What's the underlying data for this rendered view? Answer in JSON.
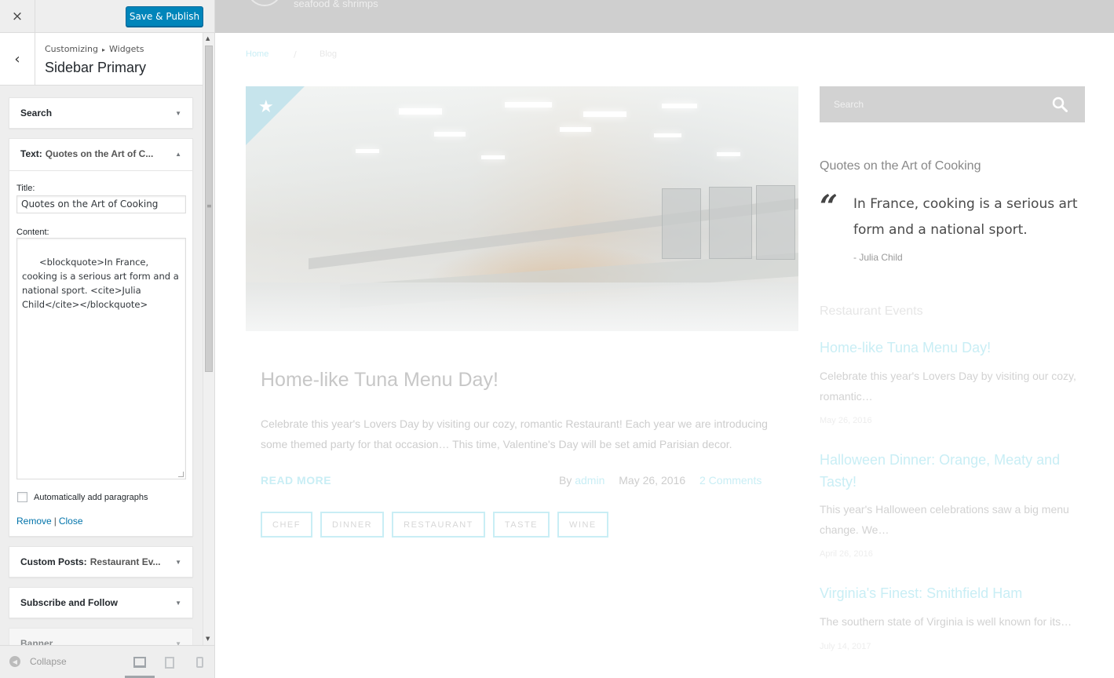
{
  "customizer": {
    "close_icon": "×",
    "publish_label": "Save & Publish",
    "back_icon": "‹",
    "breadcrumb": {
      "root": "Customizing",
      "separator": "▸",
      "current": "Widgets"
    },
    "panel_title": "Sidebar Primary",
    "widgets": {
      "search": {
        "title": "Search",
        "arrow": "▼"
      },
      "text": {
        "title": "Text:",
        "subtitle": "Quotes on the Art of C...",
        "arrow": "▲",
        "title_label": "Title:",
        "title_value": "Quotes on the Art of Cooking",
        "content_label": "Content:",
        "content_value": "<blockquote>In France, cooking is a serious art form and a national sport. <cite>Julia Child</cite></blockquote>",
        "autop_label": "Automatically add paragraphs",
        "autop_checked": false,
        "remove_label": "Remove",
        "action_separator": "|",
        "close_label": "Close"
      },
      "custom_posts": {
        "title": "Custom Posts:",
        "subtitle": "Restaurant Ev...",
        "arrow": "▼"
      },
      "subscribe": {
        "title": "Subscribe and Follow",
        "arrow": "▼"
      },
      "banner": {
        "title": "Banner",
        "arrow": "▼"
      }
    },
    "footer": {
      "collapse_label": "Collapse",
      "collapse_icon": "◀"
    }
  },
  "preview": {
    "tagline": "seafood & shrimps",
    "breadcrumb": {
      "home": "Home",
      "separator": "/",
      "current": "Blog"
    },
    "post": {
      "title": "Home-like Tuna Menu Day!",
      "excerpt": "Celebrate this year's Lovers Day by visiting our cozy, romantic Restaurant! Each year we are introducing some themed party for that occasion… This time, Valentine's Day will be set amid Parisian decor.",
      "read_more": "READ MORE",
      "by_label": "By",
      "author": "admin",
      "date": "May 26, 2016",
      "comments": "2 Comments",
      "tags": [
        "CHEF",
        "DINNER",
        "RESTAURANT",
        "TASTE",
        "WINE"
      ],
      "featured_icon": "★"
    },
    "sidebar": {
      "search_placeholder": "Search",
      "quotes_heading": "Quotes on the Art of Cooking",
      "quote_mark": "“",
      "quote_text": "In France, cooking is a serious art form and a national sport.",
      "quote_cite": "- Julia Child",
      "events_heading": "Restaurant Events",
      "events": [
        {
          "title": "Home-like Tuna Menu Day!",
          "excerpt": "Celebrate this year's Lovers Day by visiting our cozy, romantic…",
          "date": "May 26, 2016"
        },
        {
          "title": "Halloween Dinner: Orange, Meaty and Tasty!",
          "excerpt": "This year's Halloween celebrations saw a big menu change. We…",
          "date": "April 26, 2016"
        },
        {
          "title": "Virginia's Finest: Smithfield Ham",
          "excerpt": "The southern state of Virginia is well known for its…",
          "date": "July 14, 2017"
        }
      ]
    }
  },
  "colors": {
    "accent": "#0085ba",
    "link_faded": "#c9eef5",
    "header_gray": "#cfcfcf"
  }
}
